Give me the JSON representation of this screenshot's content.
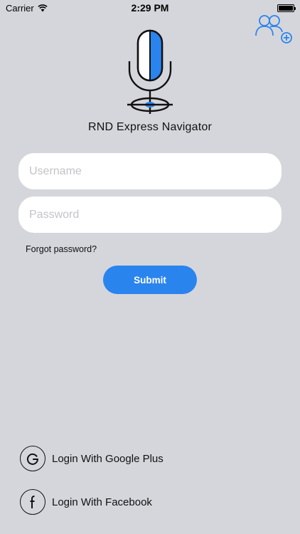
{
  "status_bar": {
    "carrier": "Carrier",
    "time": "2:29 PM"
  },
  "icons": {
    "wifi": "wifi-icon",
    "battery": "battery-icon",
    "add_user": "add-user-icon",
    "logo": "microphone-icon",
    "google": "google-plus-icon",
    "facebook": "facebook-icon"
  },
  "app": {
    "title": "RND Express Navigator"
  },
  "login_form": {
    "username_placeholder": "Username",
    "password_placeholder": "Password",
    "forgot_password": "Forgot password?",
    "submit_label": "Submit"
  },
  "social_login": {
    "google_label": "Login With Google Plus",
    "facebook_label": "Login With Facebook"
  },
  "colors": {
    "background": "#d5d6db",
    "accent": "#2a84ee",
    "field_background": "#ffffff"
  }
}
